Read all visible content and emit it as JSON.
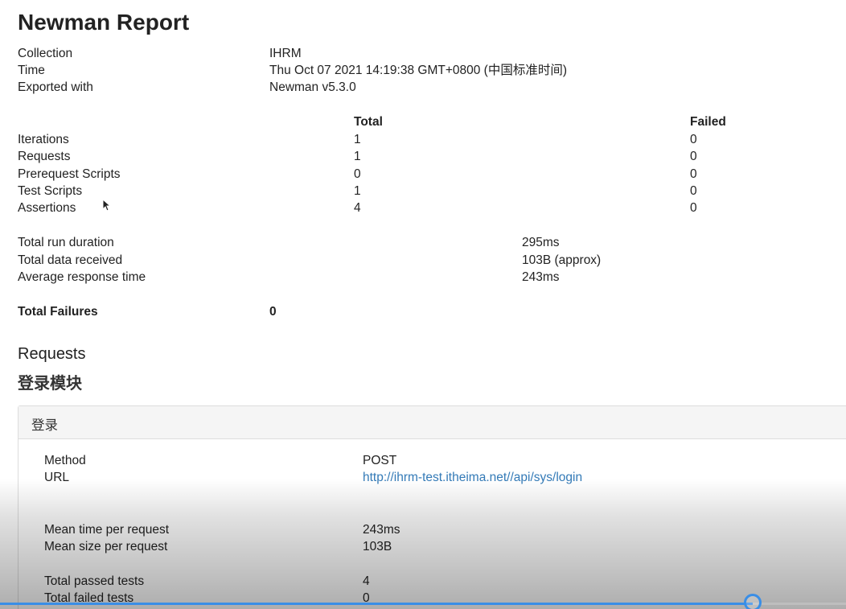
{
  "report": {
    "title": "Newman Report",
    "meta": [
      {
        "label": "Collection",
        "value": "IHRM"
      },
      {
        "label": "Time",
        "value": "Thu Oct 07 2021 14:19:38 GMT+0800 (中国标准时间)"
      },
      {
        "label": "Exported with",
        "value": "Newman v5.3.0"
      }
    ],
    "summary_headers": {
      "total": "Total",
      "failed": "Failed"
    },
    "summary": [
      {
        "label": "Iterations",
        "total": "1",
        "failed": "0"
      },
      {
        "label": "Requests",
        "total": "1",
        "failed": "0"
      },
      {
        "label": "Prerequest Scripts",
        "total": "0",
        "failed": "0"
      },
      {
        "label": "Test Scripts",
        "total": "1",
        "failed": "0"
      },
      {
        "label": "Assertions",
        "total": "4",
        "failed": "0"
      }
    ],
    "timing": [
      {
        "label": "Total run duration",
        "value": "295ms"
      },
      {
        "label": "Total data received",
        "value": "103B (approx)"
      },
      {
        "label": "Average response time",
        "value": "243ms"
      }
    ],
    "total_failures": {
      "label": "Total Failures",
      "value": "0"
    },
    "requests_heading": "Requests",
    "folder_heading": "登录模块",
    "request_panel": {
      "title": "登录",
      "method_label": "Method",
      "method_value": "POST",
      "url_label": "URL",
      "url_value": "http://ihrm-test.itheima.net//api/sys/login",
      "mean_time_label": "Mean time per request",
      "mean_time_value": "243ms",
      "mean_size_label": "Mean size per request",
      "mean_size_value": "103B",
      "passed_label": "Total passed tests",
      "passed_value": "4",
      "failed_label": "Total failed tests",
      "failed_value": "0"
    }
  },
  "video_player": {
    "progress_fraction": 0.89,
    "accent_color": "#3a8ee6"
  }
}
